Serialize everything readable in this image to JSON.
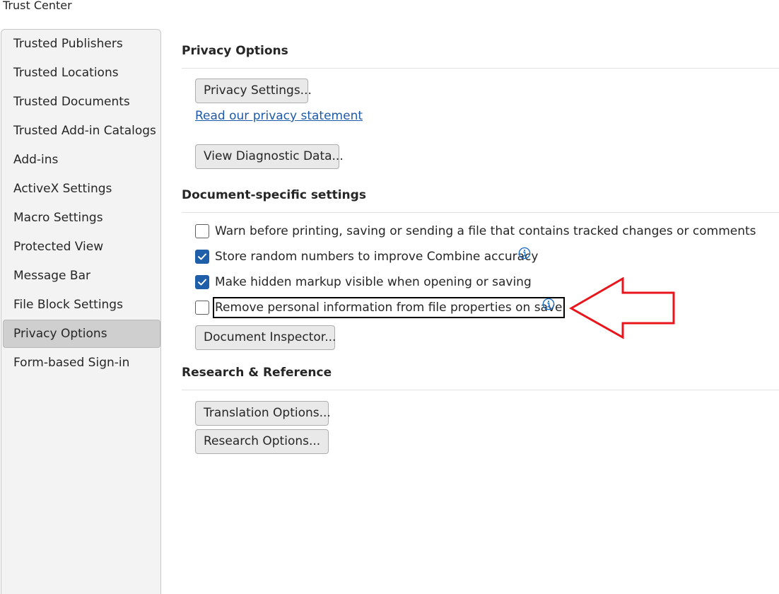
{
  "window": {
    "title": "Trust Center"
  },
  "sidebar": {
    "items": [
      {
        "label": "Trusted Publishers"
      },
      {
        "label": "Trusted Locations"
      },
      {
        "label": "Trusted Documents"
      },
      {
        "label": "Trusted Add-in Catalogs"
      },
      {
        "label": "Add-ins"
      },
      {
        "label": "ActiveX Settings"
      },
      {
        "label": "Macro Settings"
      },
      {
        "label": "Protected View"
      },
      {
        "label": "Message Bar"
      },
      {
        "label": "File Block Settings"
      },
      {
        "label": "Privacy Options",
        "selected": true
      },
      {
        "label": "Form-based Sign-in"
      }
    ]
  },
  "privacy": {
    "header": "Privacy Options",
    "privacy_settings_button": "Privacy Settings...",
    "privacy_statement_link": "Read our privacy statement",
    "view_diagnostic_button": "View Diagnostic Data..."
  },
  "document_settings": {
    "header": "Document-specific settings",
    "options": [
      {
        "label": "Warn before printing, saving or sending a file that contains tracked changes or comments",
        "checked": false
      },
      {
        "label": "Store random numbers to improve Combine accuracy",
        "checked": true,
        "info_icon": true
      },
      {
        "label": "Make hidden markup visible when opening or saving",
        "checked": true
      },
      {
        "label": "Remove personal information from file properties on save",
        "checked": false,
        "info_icon": true,
        "focused": true
      }
    ],
    "document_inspector_button": "Document Inspector..."
  },
  "research": {
    "header": "Research & Reference",
    "translation_options_button": "Translation Options...",
    "research_options_button": "Research Options..."
  },
  "annotation": {
    "type": "arrow",
    "color": "#e8161c"
  },
  "colors": {
    "accent": "#1f5ea8",
    "link": "#1e5aa8",
    "sidebar_bg": "#f3f3f3",
    "selected_bg": "#cfcfcf"
  }
}
